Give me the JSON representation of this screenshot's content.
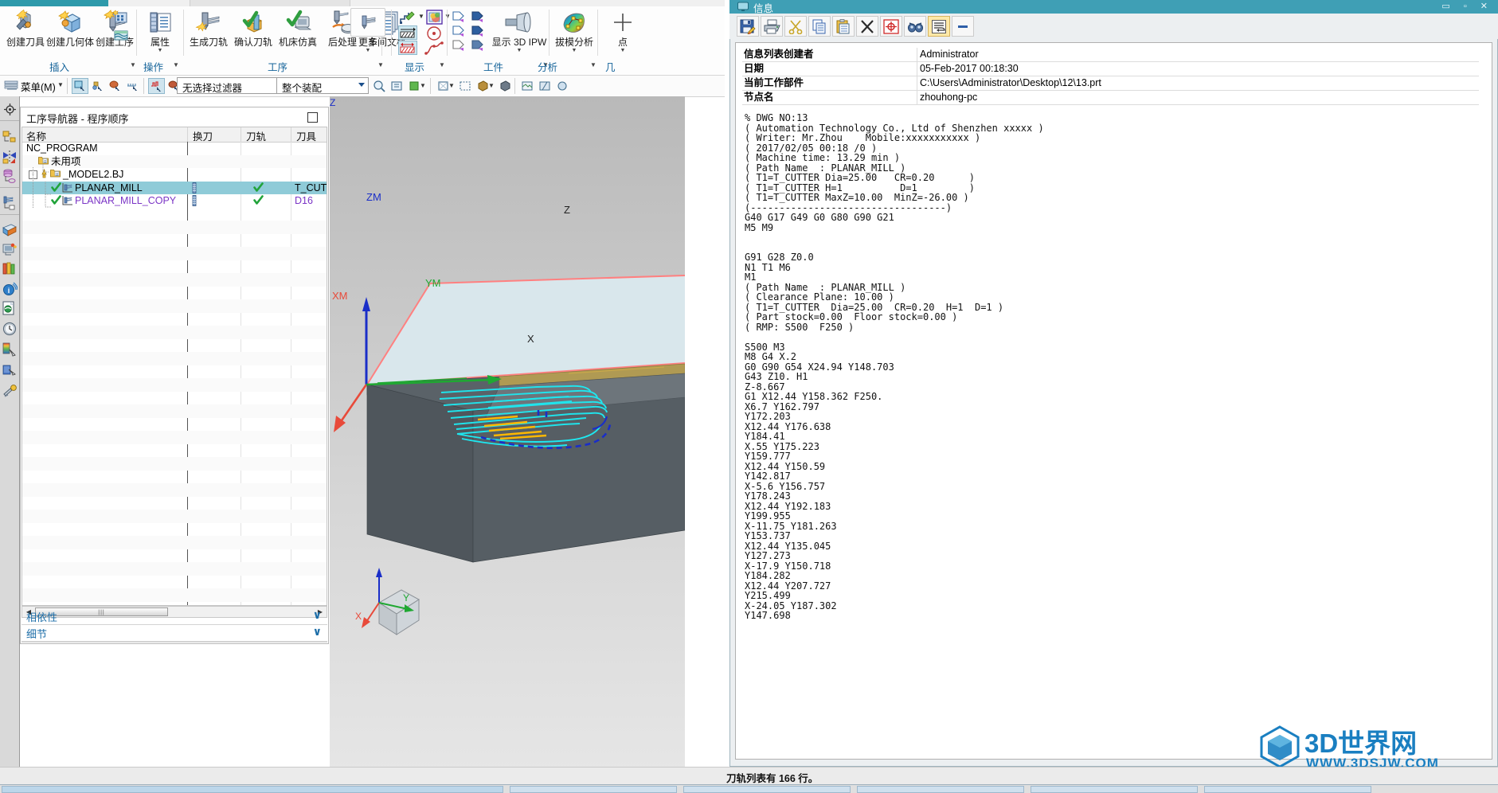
{
  "ribbon": {
    "groups": [
      {
        "title": "插入",
        "buttons": [
          {
            "label": "创建刀具",
            "icon": "create-tool-icon"
          },
          {
            "label": "创建几何体",
            "icon": "create-geometry-icon"
          },
          {
            "label": "创建工序",
            "icon": "create-operation-icon"
          }
        ]
      },
      {
        "title": "操作",
        "buttons": [
          {
            "label": "属性",
            "icon": "properties-icon"
          }
        ]
      },
      {
        "title": "工序",
        "buttons": [
          {
            "label": "生成刀轨",
            "icon": "generate-toolpath-icon"
          },
          {
            "label": "确认刀轨",
            "icon": "verify-toolpath-icon"
          },
          {
            "label": "机床仿真",
            "icon": "machine-simulation-icon"
          },
          {
            "label": "后处理",
            "icon": "post-process-icon"
          },
          {
            "label": "车间文档",
            "icon": "shop-documentation-icon"
          },
          {
            "label": "更多",
            "icon": "more-icon"
          }
        ]
      },
      {
        "title": "显示",
        "buttons": []
      },
      {
        "title": "工件",
        "buttons": [
          {
            "label": "显示 3D IPW",
            "icon": "show-3d-ipw-icon"
          }
        ]
      },
      {
        "title": "分析",
        "buttons": [
          {
            "label": "拔模分析",
            "icon": "draft-analysis-icon"
          }
        ]
      },
      {
        "title": "几",
        "buttons": [
          {
            "label": "点",
            "icon": "point-icon"
          }
        ]
      }
    ]
  },
  "toolbar2": {
    "menu_label": "菜单(M)",
    "selection_filter": "无选择过滤器",
    "scope": "整个装配",
    "icons": [
      "select-general-icon",
      "select-feature-icon",
      "select-face-icon",
      "select-edge-icon",
      "toolpath-select-icon",
      "solid-select-icon",
      "zoom-icon",
      "fit-icon",
      "rotate-icon",
      "pan-icon",
      "style-icon",
      "shaded-icon",
      "section-icon",
      "render-icon"
    ]
  },
  "resource_bar": {
    "icons": [
      "assembly-navigator-icon",
      "part-navigator-icon",
      "constraint-navigator-icon",
      "reuse-library-icon",
      "operation-navigator-icon",
      "html-help-icon",
      "web-browser-icon",
      "history-icon",
      "roles-icon",
      "system-materials-icon",
      "render-gallery-icon",
      "process-studio-icon"
    ]
  },
  "navigator": {
    "title": "工序导航器 - 程序顺序",
    "columns": [
      "名称",
      "换刀",
      "刀轨",
      "刀具"
    ],
    "rows": [
      {
        "name": "NC_PROGRAM",
        "indent": 0,
        "expander": "",
        "check": "",
        "icon": "",
        "toolchange": "",
        "path": "",
        "tool": "",
        "color": "#000000",
        "selected": false
      },
      {
        "name": "未用项",
        "indent": 1,
        "expander": "",
        "check": "",
        "icon": "folder-icon",
        "toolchange": "",
        "path": "",
        "tool": "",
        "color": "#000000",
        "selected": false
      },
      {
        "name": "_MODEL2.BJ",
        "indent": 1,
        "expander": "-",
        "check": "warn",
        "icon": "folder-icon",
        "toolchange": "",
        "path": "",
        "tool": "",
        "color": "#000000",
        "selected": false
      },
      {
        "name": "PLANAR_MILL",
        "indent": 2,
        "expander": "",
        "check": "ok",
        "icon": "operation-icon",
        "toolchange": "tool-change-icon",
        "path": "ok",
        "tool": "T_CUTTER",
        "color": "#000000",
        "selected": true
      },
      {
        "name": "PLANAR_MILL_COPY",
        "indent": 2,
        "expander": "",
        "check": "ok",
        "icon": "operation-icon",
        "toolchange": "tool-change-icon",
        "path": "ok",
        "tool": "D16",
        "color": "#7b35c6",
        "selected": false
      }
    ],
    "collapse_sections": [
      "相依性",
      "细节"
    ]
  },
  "viewport": {
    "axis_labels": [
      "ZM",
      "YM",
      "XM"
    ],
    "triad_labels": [
      "Z",
      "Y",
      "X"
    ],
    "wcs_labels": [
      "Z",
      "X"
    ]
  },
  "info_window": {
    "title": "信息",
    "window_buttons": "▭ ▫ ✕",
    "toolbar_icons": [
      "save-icon",
      "print-icon",
      "cut-icon",
      "copy-icon",
      "paste-icon",
      "delete-icon",
      "find-target-icon",
      "find-icon",
      "word-wrap-icon",
      "minus-icon"
    ],
    "meta": [
      {
        "key": "信息列表创建者",
        "value": "Administrator"
      },
      {
        "key": "日期",
        "value": "05-Feb-2017 00:18:30"
      },
      {
        "key": "当前工作部件",
        "value": "C:\\Users\\Administrator\\Desktop\\12\\13.prt"
      },
      {
        "key": "节点名",
        "value": "zhouhong-pc"
      }
    ],
    "gcode": "% DWG NO:13\n( Automation Technology Co., Ltd of Shenzhen xxxxx )\n( Writer: Mr.Zhou    Mobile:xxxxxxxxxxx )\n( 2017/02/05 00:18 /0 )\n( Machine time: 13.29 min )\n( Path Name  : PLANAR_MILL )\n( T1=T_CUTTER Dia=25.00   CR=0.20      )\n( T1=T_CUTTER H=1          D=1         )\n( T1=T_CUTTER MaxZ=10.00  MinZ=-26.00 )\n(----------------------------------)\nG40 G17 G49 G0 G80 G90 G21\nM5 M9\n\n\nG91 G28 Z0.0\nN1 T1 M6\nM1\n( Path Name  : PLANAR_MILL )\n( Clearance Plane: 10.00 )\n( T1=T_CUTTER  Dia=25.00  CR=0.20  H=1  D=1 )\n( Part stock=0.00  Floor stock=0.00 )\n( RMP: S500  F250 )\n\nS500 M3\nM8 G4 X.2\nG0 G90 G54 X24.94 Y148.703\nG43 Z10. H1\nZ-8.667\nG1 X12.44 Y158.362 F250.\nX6.7 Y162.797\nY172.203\nX12.44 Y176.638\nY184.41\nX.55 Y175.223\nY159.777\nX12.44 Y150.59\nY142.817\nX-5.6 Y156.757\nY178.243\nX12.44 Y192.183\nY199.955\nX-11.75 Y181.263\nY153.737\nX12.44 Y135.045\nY127.273\nX-17.9 Y150.718\nY184.282\nX12.44 Y207.727\nY215.499\nX-24.05 Y187.302\nY147.698"
  },
  "status": {
    "text": "刀轨列表有 166 行。"
  },
  "watermark": {
    "title": "3D世界网",
    "subtitle": "WWW.3DSJW.COM",
    "color": "#1a7fc1"
  }
}
